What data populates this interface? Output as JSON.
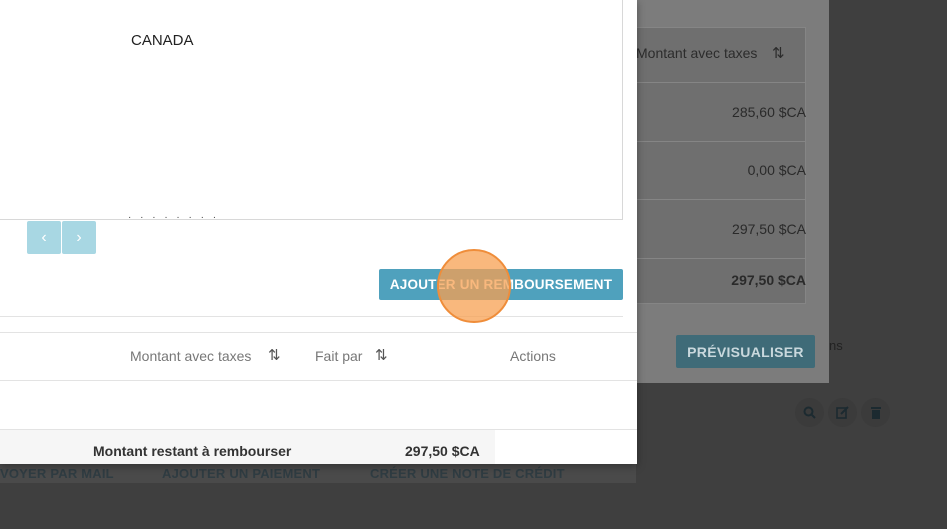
{
  "background": {
    "table": {
      "header": "Montant avec taxes",
      "rows": [
        "285,60 $CA",
        "0,00 $CA",
        "297,50 $CA"
      ],
      "total": "297,50 $CA"
    },
    "preview_button": "PRÉVISUALISER",
    "edge_text": "ns",
    "bottom_links": [
      "VOYER PAR MAIL",
      "AJOUTER UN PAIEMENT",
      "CRÉER UNE NOTE DE CRÉDIT"
    ]
  },
  "modal": {
    "document": {
      "country": "CANADA"
    },
    "pager": {
      "prev_glyph": "‹",
      "next_glyph": "›"
    },
    "refund_button": "AJOUTER UN REMBOURSEMENT",
    "refund_table": {
      "columns": {
        "amount": "Montant avec taxes",
        "made_by": "Fait par",
        "actions": "Actions"
      },
      "summary_label": "Montant restant à rembourser",
      "summary_value": "297,50 $CA"
    }
  },
  "colors": {
    "accent": "#4fa1bd",
    "pager": "#a8d7e3",
    "click_indicator": "#f7a052"
  }
}
